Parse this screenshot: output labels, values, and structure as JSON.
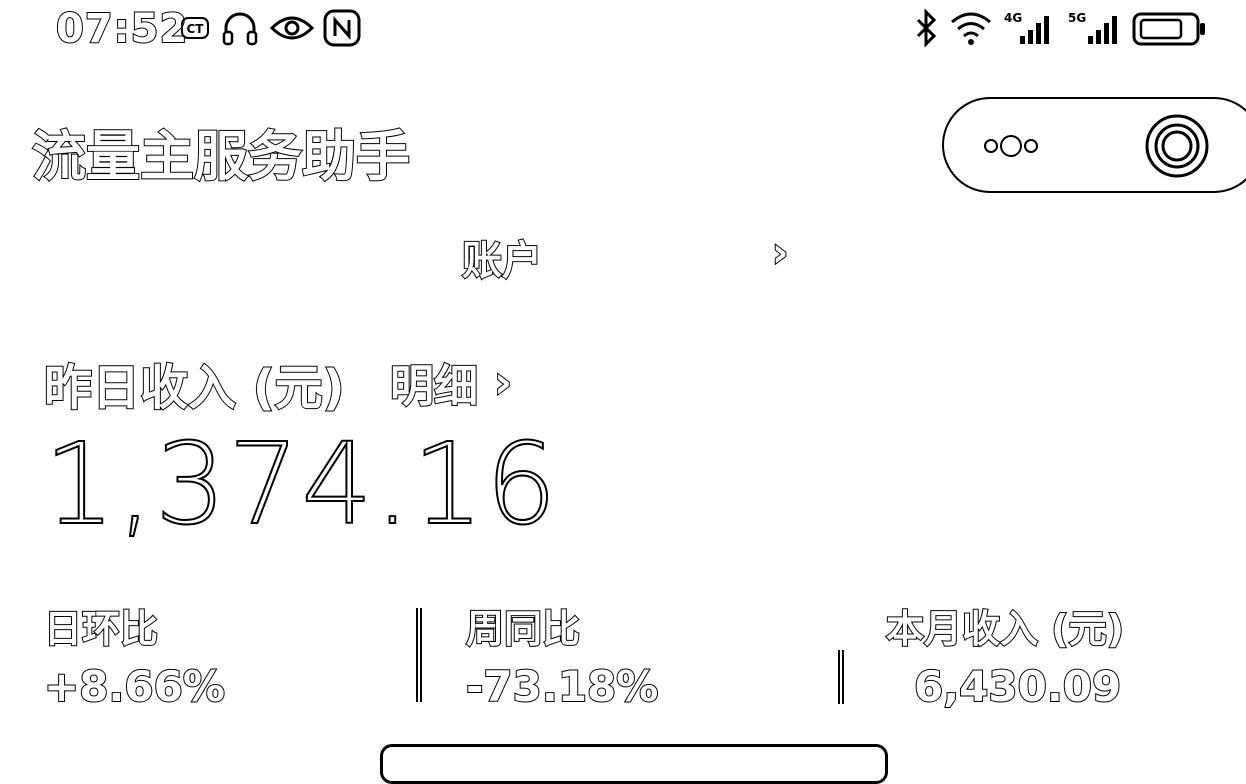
{
  "status_bar": {
    "time": "07:52",
    "carrier_badge": "CT",
    "network_4g": "4G",
    "network_5g": "5G",
    "icons": [
      "carrier-icon",
      "headphone-icon",
      "eye-icon",
      "nfc-icon",
      "bluetooth-icon",
      "wifi-icon",
      "signal-4g-icon",
      "signal-5g-icon",
      "battery-icon"
    ]
  },
  "header": {
    "title": "流量主服务助手",
    "more_icon": "more-dots-icon",
    "close_icon": "target-icon"
  },
  "account": {
    "label": "账户",
    "chevron": "›"
  },
  "income": {
    "label": "昨日收入 (元)",
    "detail_label": "明细",
    "detail_chevron": "›",
    "value": "1,374.16"
  },
  "stats": [
    {
      "label": "日环比",
      "value": "+8.66%"
    },
    {
      "label": "周同比",
      "value": "-73.18%"
    },
    {
      "label": "本月收入 (元)",
      "value": "6,430.09"
    }
  ]
}
